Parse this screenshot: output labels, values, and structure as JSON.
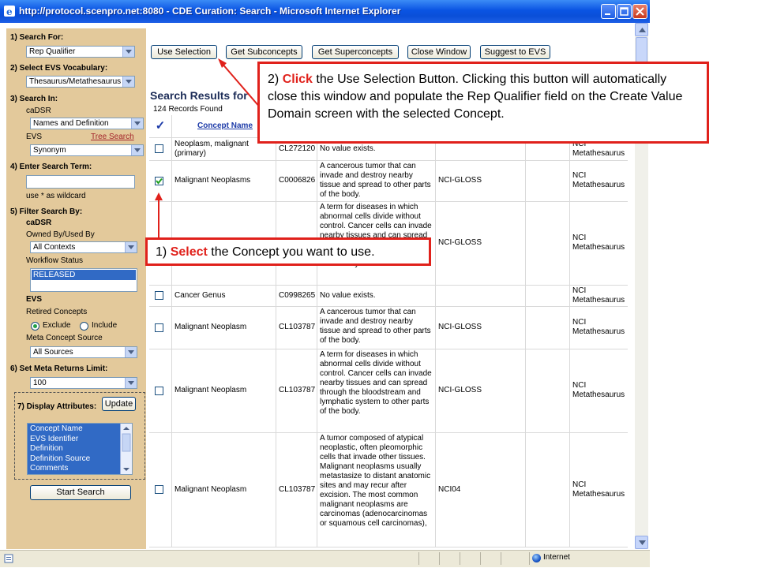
{
  "window": {
    "title": "http://protocol.scenpro.net:8080 - CDE Curation: Search - Microsoft Internet Explorer"
  },
  "status_bar": {
    "zone": "Internet"
  },
  "left_panel": {
    "search_for": {
      "label": "1) Search For:",
      "value": "Rep Qualifier"
    },
    "vocab": {
      "label": "2) Select EVS Vocabulary:",
      "value": "Thesaurus/Metathesaurus"
    },
    "search_in": {
      "label": "3) Search In:",
      "cadsr_label": "caDSR",
      "cadsr_value": "Names and Definition",
      "evs_label": "EVS",
      "tree_search": "Tree Search",
      "evs_value": "Synonym"
    },
    "search_term": {
      "label": "4) Enter Search Term:",
      "value": "",
      "hint": "use * as wildcard"
    },
    "filter": {
      "label": "5) Filter Search By:",
      "cadsr_label": "caDSR",
      "owned_label": "Owned By/Used By",
      "owned_value": "All Contexts",
      "workflow_label": "Workflow Status",
      "workflow_selected": "RELEASED",
      "evs_label": "EVS",
      "retired_label": "Retired Concepts",
      "exclude": "Exclude",
      "include": "Include",
      "meta_source_label": "Meta Concept Source",
      "meta_source_value": "All Sources"
    },
    "limit": {
      "label": "6) Set Meta Returns Limit:",
      "value": "100"
    },
    "display": {
      "label": "7) Display Attributes:",
      "update": "Update",
      "options": [
        "Concept Name",
        "EVS Identifier",
        "Definition",
        "Definition Source",
        "Comments"
      ]
    },
    "start_search": "Start Search"
  },
  "toolbar": {
    "use_selection": "Use Selection",
    "get_subconcepts": "Get Subconcepts",
    "get_superconcepts": "Get Superconcepts",
    "close_window": "Close Window",
    "suggest": "Suggest to EVS"
  },
  "results": {
    "title": "Search Results for",
    "count": "124 Records Found",
    "header_check": "✓",
    "header_concept": "Concept Name",
    "rows": [
      {
        "checked": false,
        "name": "Neoplasm, malignant (primary)",
        "id": "CL272120",
        "definition": "No value exists.",
        "source": "",
        "vocab": "NCI Metathesaurus"
      },
      {
        "checked": true,
        "name": "Malignant Neoplasms",
        "id": "C0006826",
        "definition": "A cancerous tumor that can invade and destroy nearby tissue and spread to other parts of the body.",
        "source": "NCI-GLOSS",
        "vocab": "NCI Metathesaurus"
      },
      {
        "checked": false,
        "name": "",
        "id": "",
        "definition": "A term for diseases in which abnormal cells divide without control. Cancer cells can invade nearby tissues and can spread through the bloodstream and lymphatic system to other parts of the body.",
        "source": "NCI-GLOSS",
        "vocab": "NCI Metathesaurus"
      },
      {
        "checked": false,
        "name": "Cancer Genus",
        "id": "C0998265",
        "definition": "No value exists.",
        "source": "",
        "vocab": "NCI Metathesaurus"
      },
      {
        "checked": false,
        "name": "Malignant Neoplasm",
        "id": "CL103787",
        "definition": "A cancerous tumor that can invade and destroy nearby tissue and spread to other parts of the body.",
        "source": "NCI-GLOSS",
        "vocab": "NCI Metathesaurus"
      },
      {
        "checked": false,
        "name": "Malignant Neoplasm",
        "id": "CL103787",
        "definition": "A term for diseases in which abnormal cells divide without control. Cancer cells can invade nearby tissues and can spread through the bloodstream and lymphatic system to other parts of the body.",
        "source": "NCI-GLOSS",
        "vocab": "NCI Metathesaurus"
      },
      {
        "checked": false,
        "name": "Malignant Neoplasm",
        "id": "CL103787",
        "definition": "A tumor composed of atypical neoplastic, often pleomorphic cells that invade other tissues. Malignant neoplasms usually metastasize to distant anatomic sites and may recur after excision. The most common malignant neoplasms are carcinomas (adenocarcinomas or squamous cell carcinomas),",
        "source": "NCI04",
        "vocab": "NCI Metathesaurus"
      }
    ]
  },
  "callouts": {
    "step2_num": "2)",
    "step2_em": "Click",
    "step2_text": " the Use Selection Button. Clicking this button will automatically close this window and populate the Rep Qualifier field on the Create Value Domain screen with the selected Concept.",
    "step1_num": "1)",
    "step1_em": "Select",
    "step1_text": " the Concept you want to use."
  },
  "colors": {
    "callout_red": "#e0211b",
    "panel_tan": "#e3c99b",
    "title_blue": "#0a54e3",
    "link_blue": "#1c3aa8"
  }
}
